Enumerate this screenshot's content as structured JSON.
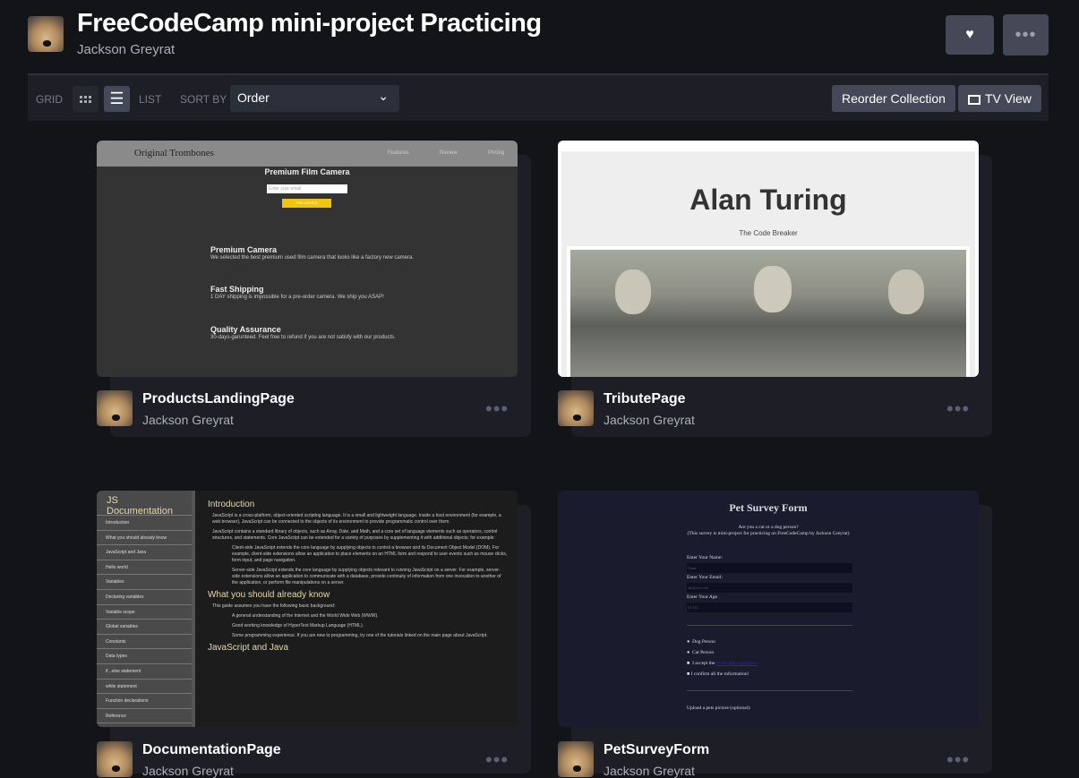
{
  "header": {
    "title": "FreeCodeCamp mini-project Practicing",
    "owner": "Jackson Greyrat",
    "like_icon": "heart-icon",
    "more_icon": "ellipsis-icon"
  },
  "toolbar": {
    "grid_label": "GRID",
    "list_label": "LIST",
    "sort_label": "SORT BY",
    "sort_value": "Order",
    "reorder": "Reorder Collection",
    "tv_view": "TV View",
    "active_view": "list"
  },
  "pens": [
    {
      "title": "ProductsLandingPage",
      "owner": "Jackson Greyrat",
      "preview": {
        "logo": "Original Trombones",
        "nav": [
          "Features",
          "Review",
          "Pricing"
        ],
        "heading": "Premium Film Camera",
        "email_placeholder": "Enter your email",
        "button": "PRE-ORDER",
        "features": [
          {
            "h": "Premium Camera",
            "p": "We selected the best premium used film camera that looks like a factory new camera."
          },
          {
            "h": "Fast Shipping",
            "p": "1 DAY shipping is impossible for a pre-order camera. We ship you ASAP!"
          },
          {
            "h": "Quality Assurance",
            "p": "30-days-garunteed. Feel free to refund if you are not satisfy with our products."
          }
        ]
      }
    },
    {
      "title": "TributePage",
      "owner": "Jackson Greyrat",
      "preview": {
        "heading": "Alan Turing",
        "subtitle": "The Code Breaker"
      }
    },
    {
      "title": "DocumentationPage",
      "owner": "Jackson Greyrat",
      "preview": {
        "nav_title": "JS Documentation",
        "nav": [
          "Introduction",
          "What you should already know",
          "JavaScript and Java",
          "Hello world",
          "Variables",
          "Declaring variables",
          "Variable scope",
          "Global variables",
          "Constants",
          "Data types",
          "if...else statement",
          "while statement",
          "Function declarations",
          "Reference"
        ],
        "h1": "Introduction",
        "p1": "JavaScript is a cross-platform, object-oriented scripting language. It is a small and lightweight language. Inside a host environment (for example, a web browser), JavaScript can be connected to the objects of its environment to provide programmatic control over them.",
        "p2": "JavaScript contains a standard library of objects, such as Array, Date, and Math, and a core set of language elements such as operators, control structures, and statements. Core JavaScript can be extended for a variety of purposes by supplementing it with additional objects; for example:",
        "li1": "Client-side JavaScript extends the core language by supplying objects to control a browser and its Document Object Model (DOM). For example, client-side extensions allow an application to place elements on an HTML form and respond to user events such as mouse clicks, form input, and page navigation.",
        "li2": "Server-side JavaScript extends the core language by supplying objects relevant to running JavaScript on a server. For example, server-side extensions allow an application to communicate with a database, provide continuity of information from one invocation to another of the application, or perform file manipulations on a server.",
        "h2": "What you should already know",
        "p3": "This guide assumes you have the following basic background:",
        "li3": "A general understanding of the Internet and the World Wide Web (WWW).",
        "li4": "Good working knowledge of HyperText Markup Language (HTML).",
        "li5": "Some programming experience. If you are new to programming, try one of the tutorials linked on the main page about JavaScript.",
        "h3": "JavaScript and Java"
      }
    },
    {
      "title": "PetSurveyForm",
      "owner": "Jackson Greyrat",
      "preview": {
        "heading": "Pet Survey Form",
        "desc1": "Are you a cat or a dog person?",
        "desc2": "(This survey is mini-project for practicing on FreeCodeCamp by Jackson Greyrat)",
        "name_label": "Enter Your Name:",
        "name_ph": "Name",
        "email_label": "Enter Your Email:",
        "email_ph": "abc@xxx.com",
        "age_label": "Enter Your Age",
        "age_ph": "13-120",
        "dog": "Dog Person",
        "cat": "Cat Person",
        "accept": "I accept the",
        "terms": "terms and conditions",
        "confirm": "I confirm all the information!",
        "upload": "Upload a pets picture (optional):"
      }
    }
  ]
}
